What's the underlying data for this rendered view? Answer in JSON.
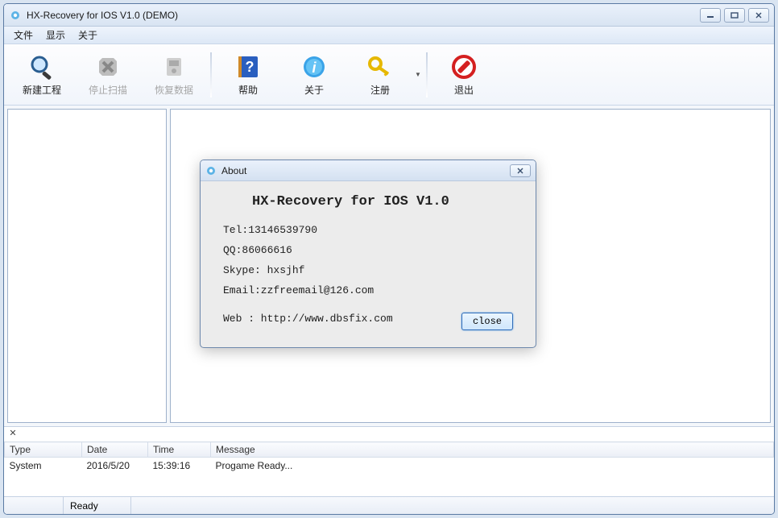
{
  "window": {
    "title": "HX-Recovery for IOS V1.0 (DEMO)"
  },
  "menu": {
    "file": "文件",
    "view": "显示",
    "about": "关于"
  },
  "toolbar": {
    "new_project": "新建工程",
    "stop_scan": "停止扫描",
    "recover": "恢复数据",
    "help": "帮助",
    "about": "关于",
    "register": "注册",
    "exit": "退出"
  },
  "log": {
    "headers": {
      "type": "Type",
      "date": "Date",
      "time": "Time",
      "message": "Message"
    },
    "rows": [
      {
        "type": "System",
        "date": "2016/5/20",
        "time": "15:39:16",
        "message": "Progame Ready..."
      }
    ]
  },
  "status": {
    "ready": "Ready"
  },
  "dialog": {
    "title": "About",
    "heading": "HX-Recovery for IOS V1.0",
    "tel": "Tel:13146539790",
    "qq": "QQ:86066616",
    "skype": "Skype: hxsjhf",
    "email": "Email:zzfreemail@126.com",
    "web": "Web : http://www.dbsfix.com",
    "close": "close"
  }
}
